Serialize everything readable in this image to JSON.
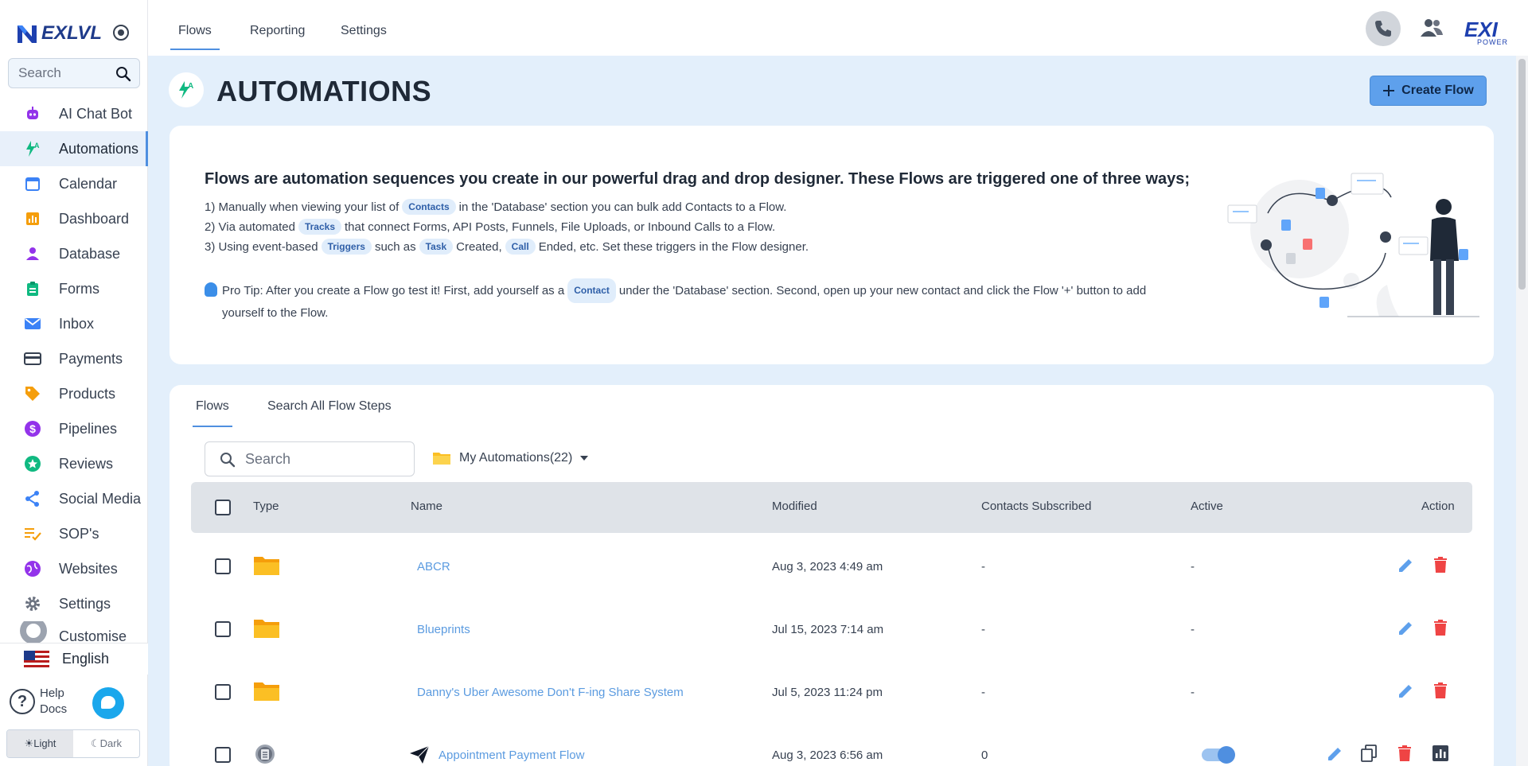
{
  "sidebar": {
    "brand": "EXLVL",
    "search_placeholder": "Search",
    "items": [
      {
        "label": "AI Chat Bot",
        "icon": "robot-icon",
        "color": "#9333ea"
      },
      {
        "label": "Automations",
        "icon": "automation-icon",
        "color": "#10b981"
      },
      {
        "label": "Calendar",
        "icon": "calendar-icon",
        "color": "#3b82f6"
      },
      {
        "label": "Dashboard",
        "icon": "bar-chart-icon",
        "color": "#f59e0b"
      },
      {
        "label": "Database",
        "icon": "person-icon",
        "color": "#9333ea"
      },
      {
        "label": "Forms",
        "icon": "clipboard-icon",
        "color": "#10b981"
      },
      {
        "label": "Inbox",
        "icon": "mail-icon",
        "color": "#3b82f6"
      },
      {
        "label": "Payments",
        "icon": "card-icon",
        "color": "#374151"
      },
      {
        "label": "Products",
        "icon": "tag-icon",
        "color": "#f59e0b"
      },
      {
        "label": "Pipelines",
        "icon": "dollar-icon",
        "color": "#9333ea"
      },
      {
        "label": "Reviews",
        "icon": "star-icon",
        "color": "#10b981"
      },
      {
        "label": "Social Media",
        "icon": "share-icon",
        "color": "#3b82f6"
      },
      {
        "label": "SOP's",
        "icon": "checklist-icon",
        "color": "#f59e0b"
      },
      {
        "label": "Websites",
        "icon": "globe-icon",
        "color": "#9333ea"
      },
      {
        "label": "Settings",
        "icon": "gear-icon",
        "color": "#6b7280"
      },
      {
        "label": "Customise",
        "icon": "palette-icon",
        "color": "#6b7280"
      }
    ],
    "language": "English",
    "help_line1": "Help",
    "help_line2": "Docs",
    "theme_light": "☀Light",
    "theme_dark": "☾Dark"
  },
  "topbar": {
    "tabs": [
      "Flows",
      "Reporting",
      "Settings"
    ],
    "brand": "EXI",
    "brand_sub": "POWER"
  },
  "header": {
    "title": "AUTOMATIONS",
    "create_button": "Create Flow"
  },
  "info": {
    "title": "Flows are automation sequences you create in our powerful drag and drop designer. These Flows are triggered one of three ways;",
    "line1_a": "1) Manually when viewing your list of",
    "line1_chip": "Contacts",
    "line1_b": "in the 'Database' section you can bulk add Contacts to a Flow.",
    "line2_a": "2) Via automated",
    "line2_chip": "Tracks",
    "line2_b": "that connect Forms, API Posts, Funnels, File Uploads, or Inbound Calls to a Flow.",
    "line3_a": "3) Using event-based",
    "line3_chip1": "Triggers",
    "line3_b": "such as",
    "line3_chip2": "Task",
    "line3_c": "Created,",
    "line3_chip3": "Call",
    "line3_d": "Ended, etc. Set these triggers in the Flow designer.",
    "tip_a": "Pro Tip: After you create a Flow go test it! First, add yourself as a",
    "tip_chip": "Contact",
    "tip_b": "under the 'Database' section. Second, open up your new contact and click the Flow '+' button to add yourself to the Flow."
  },
  "flows": {
    "tabs": [
      "Flows",
      "Search All Flow Steps"
    ],
    "search_placeholder": "Search",
    "folder_label": "My Automations(22)",
    "columns": [
      "Type",
      "Name",
      "Modified",
      "Contacts Subscribed",
      "Active",
      "Action"
    ],
    "rows": [
      {
        "type": "folder",
        "name": "ABCR",
        "modified": "Aug 3, 2023 4:49 am",
        "contacts": "-",
        "active": "-"
      },
      {
        "type": "folder",
        "name": "Blueprints",
        "modified": "Jul 15, 2023 7:14 am",
        "contacts": "-",
        "active": "-"
      },
      {
        "type": "folder",
        "name": "Danny's Uber Awesome Don't F-ing Share System",
        "modified": "Jul 5, 2023 11:24 pm",
        "contacts": "-",
        "active": "-"
      },
      {
        "type": "flow",
        "name": "Appointment Payment Flow",
        "modified": "Aug 3, 2023 6:56 am",
        "contacts": "0",
        "active": true
      }
    ]
  },
  "colors": {
    "accent": "#5ea0ec",
    "link": "#5b9be0",
    "folder": "#fbbf24",
    "delete": "#ef4444"
  }
}
